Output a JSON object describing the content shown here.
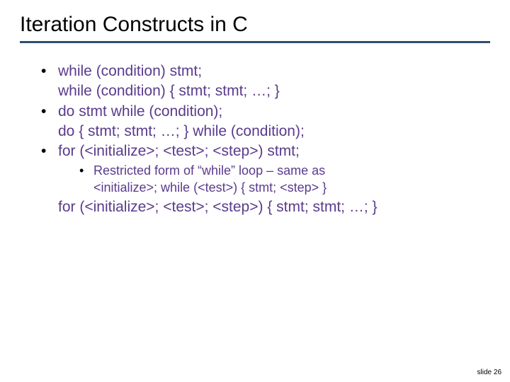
{
  "title": "Iteration Constructs in C",
  "bullets": {
    "b1": "while (condition) stmt;",
    "b1b": "while (condition) { stmt; stmt; …; }",
    "b2": "do stmt while (condition);",
    "b2b": "do { stmt; stmt; …; } while (condition);",
    "b3": "for (<initialize>; <test>; <step>) stmt;",
    "sub1": "Restricted form of “while” loop – same as",
    "sub1b": "<initialize>; while (<test>) { stmt; <step> }",
    "b3b": "for (<initialize>; <test>; <step>) { stmt; stmt; …; }"
  },
  "footer": "slide 26"
}
